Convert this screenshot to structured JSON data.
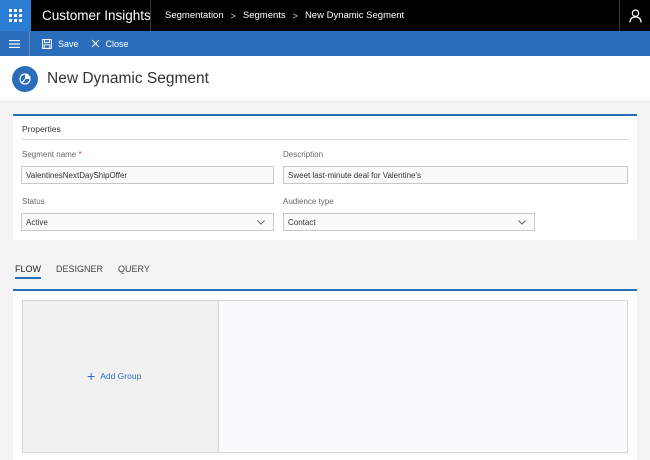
{
  "app": {
    "title": "Customer Insights"
  },
  "breadcrumb": [
    "Segmentation",
    "Segments",
    "New Dynamic Segment"
  ],
  "commandbar": {
    "save_label": "Save",
    "close_label": "Close"
  },
  "page": {
    "title": "New Dynamic Segment"
  },
  "properties": {
    "title": "Properties",
    "segment_name": {
      "label": "Segment name",
      "required_mark": "*",
      "value": "ValentinesNextDayShipOffer"
    },
    "description": {
      "label": "Description",
      "value": "Sweet last-minute deal for Valentine's"
    },
    "status": {
      "label": "Status",
      "value": "Active"
    },
    "audience_type": {
      "label": "Audience type",
      "value": "Contact"
    }
  },
  "tabs": [
    "FLOW",
    "DESIGNER",
    "QUERY"
  ],
  "designer": {
    "add_group_label": "Add Group"
  },
  "colors": {
    "accent": "#2a6ebb",
    "topbar": "#000000",
    "commandbar": "#2a6ebb"
  }
}
